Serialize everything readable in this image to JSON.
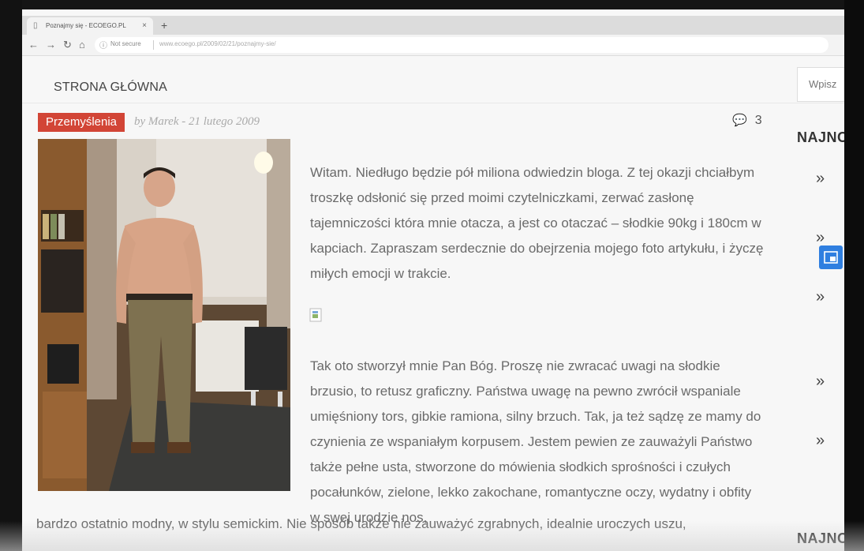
{
  "browser": {
    "tab_title": "Poznajmy się - ECOEGO.PL",
    "tab_close": "×",
    "new_tab": "+",
    "security_label": "Not secure",
    "url": "www.ecoego.pl/2009/02/21/poznajmy-sie/"
  },
  "site": {
    "nav_home": "STRONA GŁÓWNA",
    "search_placeholder": "Wpisz"
  },
  "post": {
    "category": "Przemyślenia",
    "byline": "by Marek - 21 lutego 2009",
    "comment_count": "3",
    "paragraph1": "Witam. Niedługo będzie pół miliona odwiedzin bloga. Z tej okazji chciałbym troszkę odsłonić się przed moimi czytelniczkami, zerwać zasłonę tajemniczości która mnie otacza, a jest co otaczać – słodkie 90kg i 180cm w kapciach. Zapraszam serdecznie do obejrzenia mojego foto artykułu, i życzę miłych emocji w trakcie.",
    "paragraph2": "Tak oto stworzył mnie Pan Bóg. Proszę nie zwracać uwagi na słodkie brzusio, to retusz graficzny. Państwa uwagę na pewno zwrócił wspaniale umięśniony tors, gibkie ramiona, silny brzuch. Tak, ja też sądzę ze mamy do czynienia ze wspaniałym korpusem. Jestem pewien ze zauważyli Państwo także pełne usta, stworzone do mówienia słodkich sprośności i czułych pocałunków, zielone, lekko zakochane, romantyczne oczy, wydatny i obfity w swej urodzie nos,",
    "bottom_text": "bardzo ostatnio modny, w stylu semickim. Nie sposób także nie zauważyć zgrabnych, idealnie uroczych uszu,"
  },
  "sidebar": {
    "heading": "NAJNO",
    "arrow": "»"
  },
  "colors": {
    "category_bg": "#d24536",
    "floating_button": "#2f7fe0"
  }
}
